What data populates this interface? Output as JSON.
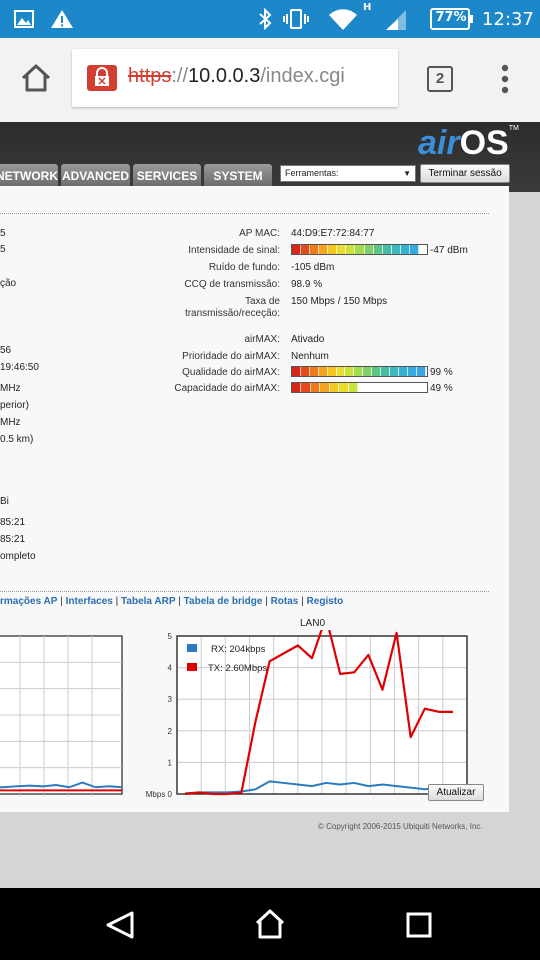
{
  "status_bar": {
    "time": "12:37",
    "battery": "77%",
    "network_type": "H",
    "icons": [
      "image-icon",
      "warning-icon",
      "bluetooth-icon",
      "vibrate-icon",
      "wifi-icon",
      "signal-icon",
      "battery-icon"
    ]
  },
  "browser": {
    "url_scheme": "https",
    "url_sep": "://",
    "url_host": "10.0.0.3",
    "url_path": "/index.cgi",
    "tab_count": "2",
    "icons": [
      "home-icon",
      "insecure-lock-icon",
      "tabs-icon",
      "more-menu-icon"
    ]
  },
  "airos": {
    "logo_air": "air",
    "logo_os": "OS",
    "logo_tm": "TM",
    "tabs": [
      "NETWORK",
      "ADVANCED",
      "SERVICES",
      "SYSTEM"
    ],
    "tools_select": "Ferramentas:",
    "logout_button": "Terminar sessão"
  },
  "left_fragments": [
    "5",
    "5",
    "ção",
    "56",
    "19:46:50",
    "MHz",
    "perior)",
    "MHz",
    "0.5 km)",
    "Bi",
    "85:21",
    "85:21",
    "ompleto"
  ],
  "fields": [
    {
      "label": "AP MAC:",
      "value": "44:D9:E7:72:84:77"
    },
    {
      "label": "Intensidade de sinal:",
      "value": "-47 dBm",
      "bar_fraction": 0.94
    },
    {
      "label": "Ruído de fundo:",
      "value": "-105 dBm"
    },
    {
      "label": "CCQ de transmissão:",
      "value": "98.9 %"
    },
    {
      "label_line1": "Taxa de",
      "label_line2": "transmissão/receção:",
      "value": "150 Mbps / 150 Mbps"
    },
    {
      "label": "airMAX:",
      "value": "Ativado"
    },
    {
      "label": "Prioridade do airMAX:",
      "value": "Nenhum"
    },
    {
      "label": "Qualidade do airMAX:",
      "value": "99 %",
      "bar_fraction": 0.99
    },
    {
      "label": "Capacidade do airMAX:",
      "value": "49 %",
      "bar_fraction": 0.49
    }
  ],
  "links": {
    "items": [
      "rmações AP",
      "Interfaces",
      "Tabela ARP",
      "Tabela de bridge",
      "Rotas",
      "Registo"
    ],
    "separator": "|"
  },
  "lan_chart_title": "LAN0",
  "chart_data": [
    {
      "type": "line",
      "title": "",
      "partial": true,
      "series": [
        {
          "name": "RX",
          "color": "#2a7bbf",
          "values": [
            0.15,
            0.15,
            0.18,
            0.2,
            0.18,
            0.22,
            0.15,
            0.3,
            0.15,
            0.18,
            0.15
          ]
        },
        {
          "name": "TX",
          "color": "#e00000",
          "values": [
            0.05,
            0.05,
            0.05,
            0.05,
            0.05,
            0.05,
            0.05,
            0.05,
            0.05,
            0.05,
            0.05
          ]
        }
      ]
    },
    {
      "type": "line",
      "title": "LAN0",
      "ylabel": "Mbps",
      "ylim": [
        0,
        5
      ],
      "yticks": [
        "0",
        "1",
        "2",
        "3",
        "4",
        "5"
      ],
      "legend": {
        "rx": "RX: 204kbps",
        "tx": "TX: 2.60Mbps",
        "position": "top-left"
      },
      "grid": true,
      "series": [
        {
          "name": "RX: 204kbps",
          "color": "#2a7bbf",
          "values": [
            0.02,
            0.05,
            0.05,
            0.05,
            0.08,
            0.15,
            0.4,
            0.35,
            0.3,
            0.25,
            0.35,
            0.3,
            0.35,
            0.25,
            0.3,
            0.25,
            0.2,
            0.15,
            0.2,
            0.25
          ]
        },
        {
          "name": "TX: 2.60Mbps",
          "color": "#e00000",
          "values": [
            0.0,
            0.05,
            0.0,
            0.0,
            0.05,
            2.3,
            4.2,
            4.45,
            4.7,
            4.3,
            5.6,
            3.8,
            3.85,
            4.4,
            3.3,
            5.1,
            1.8,
            2.7,
            2.6,
            2.6
          ]
        }
      ]
    }
  ],
  "update_button": "Atualizar",
  "copyright": "© Copyright 2006-2015 Ubiquiti Networks, Inc.",
  "colors": {
    "status_bar": "#1c87c9",
    "airos_blue": "#2a6fb0",
    "rx": "#2a7bbf",
    "tx": "#e00000"
  }
}
